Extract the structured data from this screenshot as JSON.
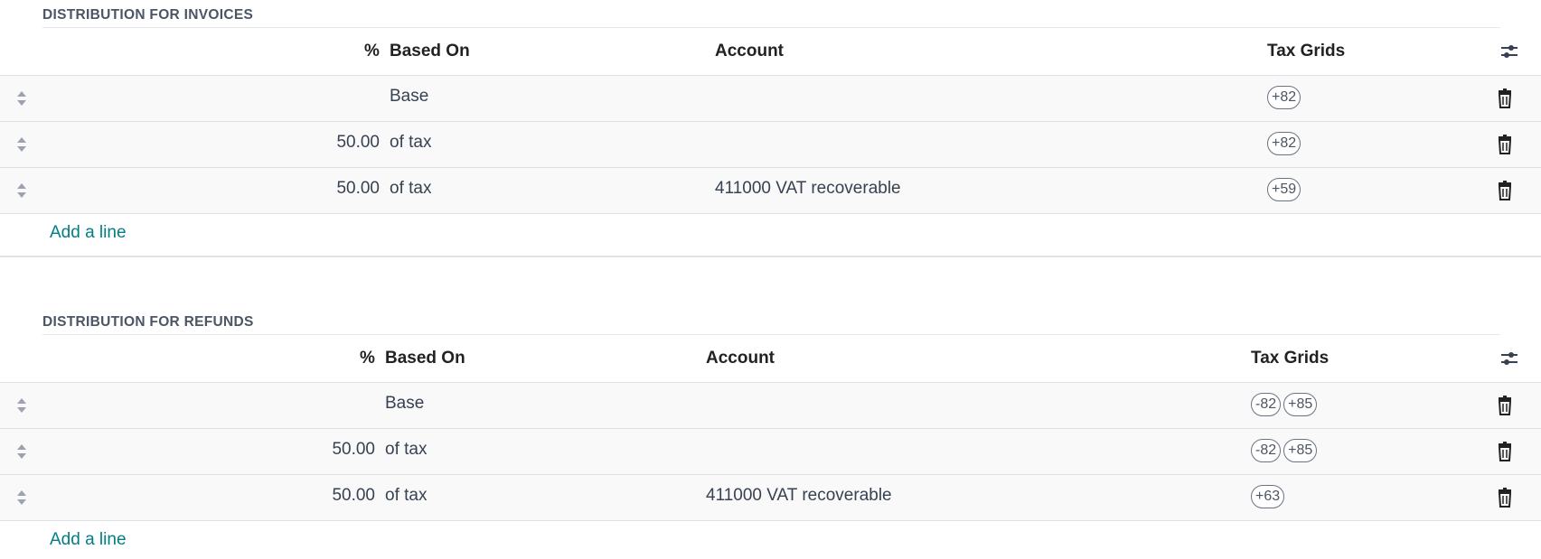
{
  "invoices": {
    "title": "DISTRIBUTION FOR INVOICES",
    "headers": {
      "percent": "%",
      "based_on": "Based On",
      "account": "Account",
      "tax_grids": "Tax Grids"
    },
    "rows": [
      {
        "percent": "",
        "based_on": "Base",
        "account": "",
        "tags": [
          "+82"
        ]
      },
      {
        "percent": "50.00",
        "based_on": "of tax",
        "account": "",
        "tags": [
          "+82"
        ]
      },
      {
        "percent": "50.00",
        "based_on": "of tax",
        "account": "411000 VAT recoverable",
        "tags": [
          "+59"
        ]
      }
    ],
    "add_line": "Add a line"
  },
  "refunds": {
    "title": "DISTRIBUTION FOR REFUNDS",
    "headers": {
      "percent": "%",
      "based_on": "Based On",
      "account": "Account",
      "tax_grids": "Tax Grids"
    },
    "rows": [
      {
        "percent": "",
        "based_on": "Base",
        "account": "",
        "tags": [
          "-82",
          "+85"
        ]
      },
      {
        "percent": "50.00",
        "based_on": "of tax",
        "account": "",
        "tags": [
          "-82",
          "+85"
        ]
      },
      {
        "percent": "50.00",
        "based_on": "of tax",
        "account": "411000 VAT recoverable",
        "tags": [
          "+63"
        ]
      }
    ],
    "add_line": "Add a line"
  },
  "colors": {
    "link": "#017e84",
    "row_bg": "#f9f9fa",
    "border": "#dee2e6"
  },
  "icons": {
    "handle": "sort-handle-icon",
    "delete": "trash-icon",
    "settings": "optional-columns-icon"
  }
}
